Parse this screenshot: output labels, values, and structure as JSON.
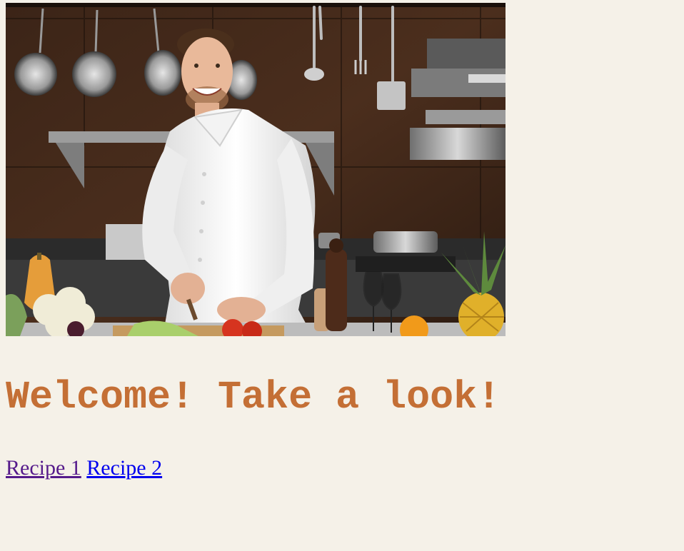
{
  "hero": {
    "image_description_icon": "chef-photo"
  },
  "heading": "Welcome! Take a look!",
  "links": [
    {
      "label": "Recipe 1",
      "state": "visited"
    },
    {
      "label": "Recipe 2",
      "state": "unvisited"
    }
  ],
  "colors": {
    "background": "#f5f1e8",
    "heading": "#c46f35",
    "link_visited": "#551a8b",
    "link_unvisited": "#0000ee"
  }
}
